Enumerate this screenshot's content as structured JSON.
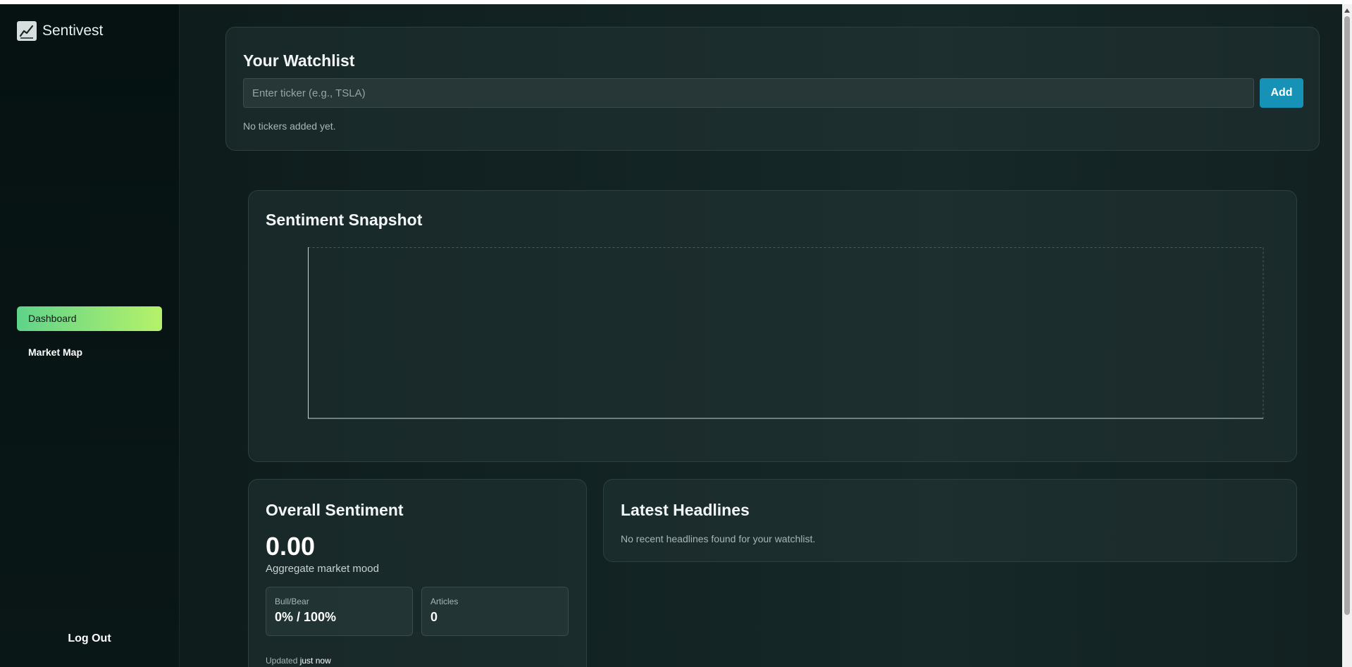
{
  "sidebar": {
    "brand": "Sentivest",
    "items": [
      {
        "label": "Dashboard",
        "active": true
      },
      {
        "label": "Market Map",
        "active": false
      }
    ],
    "logout_label": "Log Out"
  },
  "watchlist": {
    "title": "Your Watchlist",
    "input_placeholder": "Enter ticker (e.g., TSLA)",
    "input_value": "",
    "add_label": "Add",
    "empty_text": "No tickers added yet."
  },
  "snapshot": {
    "title": "Sentiment Snapshot"
  },
  "overall": {
    "title": "Overall Sentiment",
    "score": "0.00",
    "subtitle": "Aggregate market mood",
    "bull_bear_label": "Bull/Bear",
    "bull_bear_value": "0% / 100%",
    "articles_label": "Articles",
    "articles_value": "0",
    "updated_label": "Updated",
    "updated_value": "just now"
  },
  "headlines": {
    "title": "Latest Headlines",
    "empty_text": "No recent headlines found for your watchlist."
  },
  "colors": {
    "accent_start": "#5fd38a",
    "accent_end": "#b6f26a",
    "add_button": "#1592b6",
    "background": "#122222"
  }
}
